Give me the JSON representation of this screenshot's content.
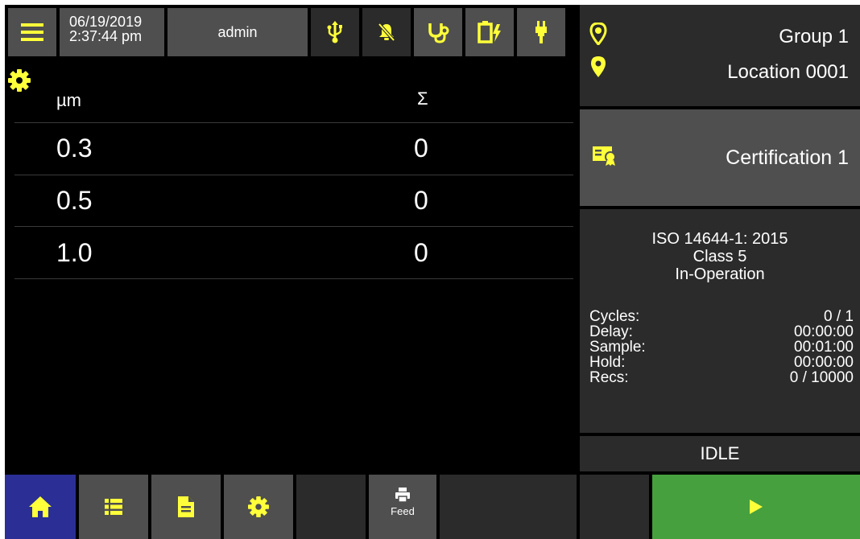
{
  "header": {
    "date": "06/19/2019",
    "time": "2:37:44 pm",
    "user": "admin",
    "icons": [
      "menu-icon",
      "usb-icon",
      "bell-off-icon",
      "stethoscope-icon",
      "battery-charging-icon",
      "probe-icon"
    ]
  },
  "table": {
    "col_size": "µm",
    "col_sum": "Σ",
    "rows": [
      {
        "size": "0.3",
        "sum": "0"
      },
      {
        "size": "0.5",
        "sum": "0"
      },
      {
        "size": "1.0",
        "sum": "0"
      }
    ]
  },
  "right": {
    "group": "Group 1",
    "location": "Location 0001",
    "certification": "Certification 1",
    "standard": "ISO 14644-1: 2015",
    "class": "Class 5",
    "state": "In-Operation",
    "stats": [
      {
        "label": "Cycles:",
        "value": "0 / 1"
      },
      {
        "label": "Delay:",
        "value": "00:00:00"
      },
      {
        "label": "Sample:",
        "value": "00:01:00"
      },
      {
        "label": "Hold:",
        "value": "00:00:00"
      },
      {
        "label": "Recs:",
        "value": "0 / 10000"
      }
    ],
    "status": "IDLE"
  },
  "footer": {
    "feed_label": "Feed"
  },
  "colors": {
    "accent_yellow": "#ffff3a",
    "home_blue": "#2a2e95",
    "start_green": "#46a03e",
    "tile_gray": "#4f4f4f"
  }
}
